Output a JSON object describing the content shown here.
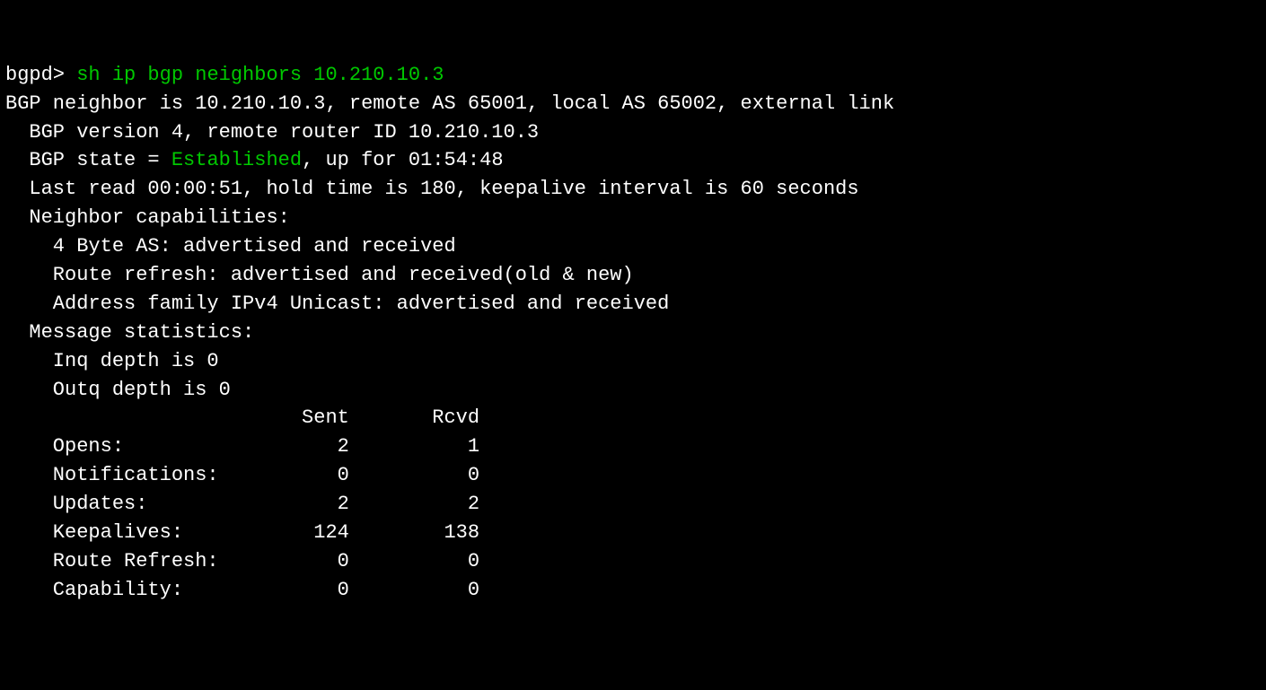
{
  "prompt": "bgpd> ",
  "command": "sh ip bgp neighbors 10.210.10.3",
  "line1_a": "BGP neighbor is 10.210.10.3, remote AS 65001, local AS 65002, external link",
  "line2": "  BGP version 4, remote router ID 10.210.10.3",
  "line3_a": "  BGP state = ",
  "line3_state": "Established",
  "line3_b": ", up for 01:54:48",
  "line4": "  Last read 00:00:51, hold time is 180, keepalive interval is 60 seconds",
  "line5": "  Neighbor capabilities:",
  "line6": "    4 Byte AS: advertised and received",
  "line7": "    Route refresh: advertised and received(old & new)",
  "line8": "    Address family IPv4 Unicast: advertised and received",
  "line9": "  Message statistics:",
  "line10": "    Inq depth is 0",
  "line11": "    Outq depth is 0",
  "stats": {
    "header": "                         Sent       Rcvd",
    "opens": "    Opens:                  2          1",
    "notifications": "    Notifications:          0          0",
    "updates": "    Updates:                2          2",
    "keepalives": "    Keepalives:           124        138",
    "routerefresh": "    Route Refresh:          0          0",
    "capability": "    Capability:             0          0"
  }
}
